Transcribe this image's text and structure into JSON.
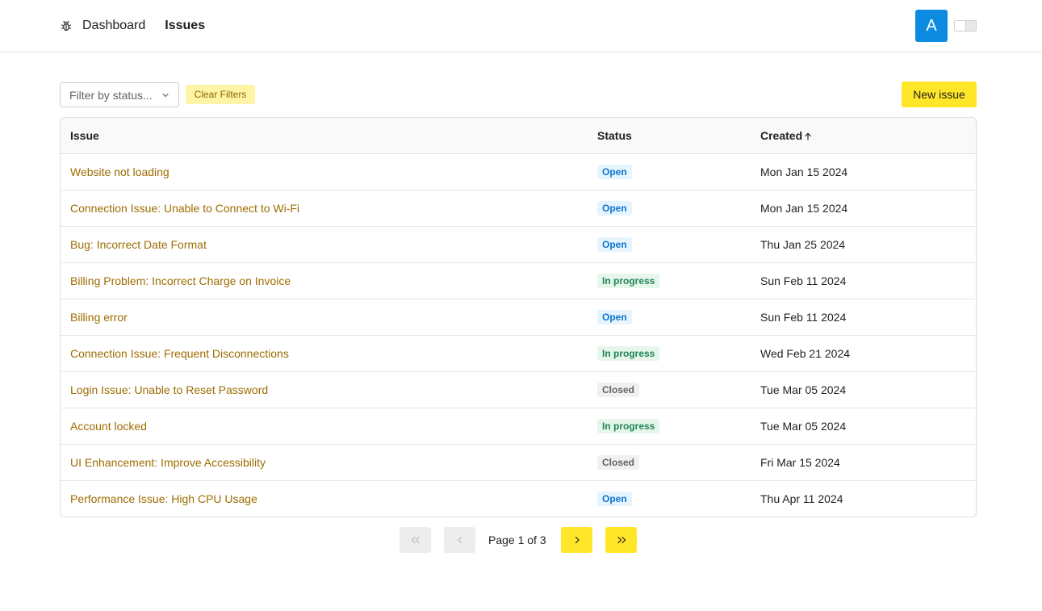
{
  "nav": {
    "logo_icon": "bug-icon",
    "links": [
      {
        "label": "Dashboard"
      },
      {
        "label": "Issues"
      }
    ]
  },
  "user": {
    "avatar_initial": "A",
    "avatar_color": "#0d8be0"
  },
  "toolbar": {
    "filter_placeholder": "Filter by status...",
    "clear_label": "Clear Filters",
    "new_label": "New issue"
  },
  "table": {
    "headers": {
      "issue": "Issue",
      "status": "Status",
      "created": "Created"
    },
    "sort": {
      "column": "Created",
      "direction": "ascending",
      "icon": "arrow-up-icon"
    },
    "rows": [
      {
        "title": "Website not loading",
        "status": "Open",
        "created": "Mon Jan 15 2024"
      },
      {
        "title": "Connection Issue: Unable to Connect to Wi-Fi",
        "status": "Open",
        "created": "Mon Jan 15 2024"
      },
      {
        "title": "Bug: Incorrect Date Format",
        "status": "Open",
        "created": "Thu Jan 25 2024"
      },
      {
        "title": "Billing Problem: Incorrect Charge on Invoice",
        "status": "In progress",
        "created": "Sun Feb 11 2024"
      },
      {
        "title": "Billing error",
        "status": "Open",
        "created": "Sun Feb 11 2024"
      },
      {
        "title": "Connection Issue: Frequent Disconnections",
        "status": "In progress",
        "created": "Wed Feb 21 2024"
      },
      {
        "title": "Login Issue: Unable to Reset Password",
        "status": "Closed",
        "created": "Tue Mar 05 2024"
      },
      {
        "title": "Account locked",
        "status": "In progress",
        "created": "Tue Mar 05 2024"
      },
      {
        "title": "UI Enhancement: Improve Accessibility",
        "status": "Closed",
        "created": "Fri Mar 15 2024"
      },
      {
        "title": "Performance Issue: High CPU Usage",
        "status": "Open",
        "created": "Thu Apr 11 2024"
      }
    ]
  },
  "pagination": {
    "label": "Page 1 of 3",
    "current_page": 1,
    "total_pages": 3
  },
  "colors": {
    "accent": "#ffe629",
    "link": "#9e6c00",
    "status_open": "#0d74ce",
    "status_in_progress": "#218358",
    "status_closed": "#646464"
  }
}
